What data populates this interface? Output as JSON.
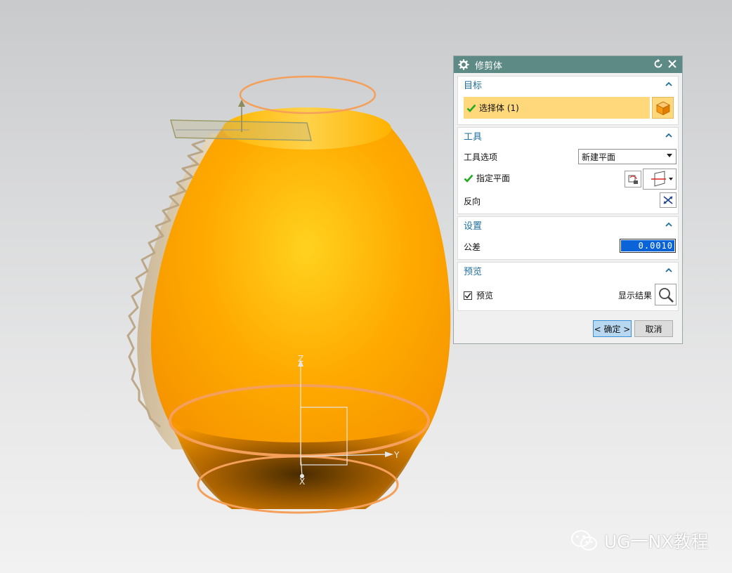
{
  "dialog": {
    "title": "修剪体",
    "target": {
      "heading": "目标",
      "select_body": "选择体 (1)"
    },
    "tool": {
      "heading": "工具",
      "tool_option_label": "工具选项",
      "tool_option_value": "新建平面",
      "specify_plane": "指定平面",
      "reverse": "反向"
    },
    "settings": {
      "heading": "设置",
      "tolerance_label": "公差",
      "tolerance_value": "0.0010"
    },
    "preview": {
      "heading": "预览",
      "preview_label": "预览",
      "preview_checked": true,
      "show_result": "显示结果"
    },
    "ok_label": "< 确定 >",
    "cancel_label": "取消"
  },
  "viewport": {
    "axis_z": "Z",
    "axis_y": "Y",
    "axis_x": "X",
    "body_color": "#ffa500",
    "highlight_color": "#f5a05a"
  },
  "watermark": "UG一NX教程",
  "colors": {
    "title_bar": "#5d8a84",
    "group_heading": "#1f6f9c",
    "selection_bg": "#fed87a",
    "check": "#22aa22"
  }
}
